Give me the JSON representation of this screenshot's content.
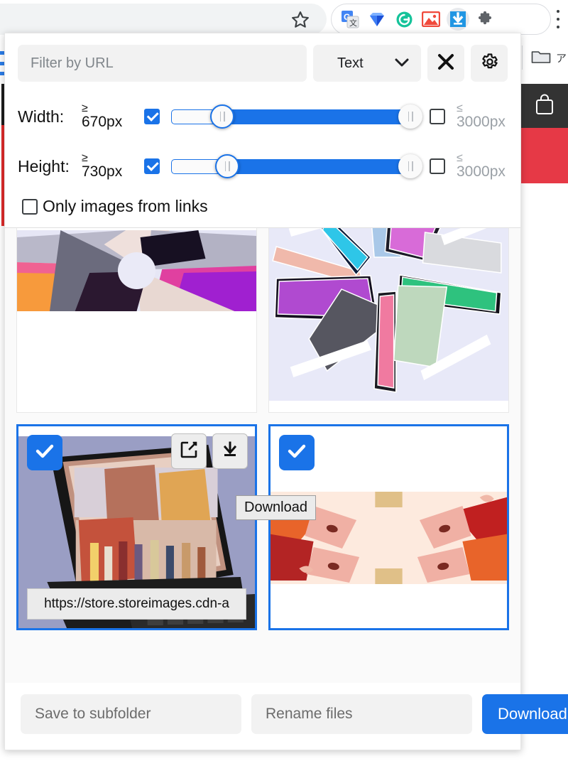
{
  "browser": {
    "star_icon": "star-icon",
    "menu_icon": "kebab-menu-icon",
    "extensions": [
      {
        "name": "google-translate-extension-icon",
        "label": "Google Translate"
      },
      {
        "name": "diamond-extension-icon",
        "label": "Diamond"
      },
      {
        "name": "grammarly-extension-icon",
        "label": "Grammarly"
      },
      {
        "name": "image-extension-icon",
        "label": "Image Downloader"
      },
      {
        "name": "download-all-images-extension-icon",
        "label": "Download All Images"
      },
      {
        "name": "puzzle-extensions-icon",
        "label": "Extensions"
      }
    ],
    "bookmark": {
      "icon": "folder-icon",
      "label": "ア"
    }
  },
  "popup": {
    "filter": {
      "placeholder": "Filter by URL",
      "value": "",
      "type_select": {
        "value": "Text",
        "chevron": "chevron-down-icon"
      },
      "clear_icon": "close-x-icon",
      "settings_icon": "gear-icon"
    },
    "size_filters": [
      {
        "label": "Width:",
        "min_op": "≥",
        "min_value": "670px",
        "min_enabled": true,
        "max_op": "≤",
        "max_value": "3000px",
        "max_enabled": false,
        "fill_start_pct": 21,
        "fill_end_pct": 98
      },
      {
        "label": "Height:",
        "min_op": "≥",
        "min_value": "730px",
        "min_enabled": true,
        "max_op": "≤",
        "max_value": "3000px",
        "max_enabled": false,
        "fill_start_pct": 23,
        "fill_end_pct": 98
      }
    ],
    "only_links": {
      "label": "Only images from links",
      "checked": false
    },
    "tiles": [
      {
        "name": "image-tile-1",
        "selected": false,
        "artwork": "ipad-mini-pinwheel",
        "url": "",
        "show_url": false,
        "show_actions": false,
        "checked": false
      },
      {
        "name": "image-tile-2",
        "selected": false,
        "artwork": "ipad-air-radial",
        "url": "",
        "show_url": false,
        "show_actions": false,
        "checked": false
      },
      {
        "name": "image-tile-3",
        "selected": true,
        "artwork": "ipad-pro-keyboard",
        "url": "https://store.storeimages.cdn-a",
        "show_url": true,
        "show_actions": true,
        "checked": true,
        "open_icon": "open-in-new-tab-icon",
        "download_icon": "download-icon"
      },
      {
        "name": "image-tile-4",
        "selected": true,
        "artwork": "red-orange-mirror",
        "url": "",
        "show_url": false,
        "show_actions": false,
        "checked": true
      }
    ],
    "tooltip": {
      "text": "Download"
    },
    "bottom": {
      "subfolder_placeholder": "Save to subfolder",
      "subfolder_value": "",
      "rename_placeholder": "Rename files",
      "rename_value": "",
      "download_label": "Download"
    }
  },
  "colors": {
    "accent_blue": "#1a73e8",
    "field_grey": "#f2f2f2",
    "grid_bg": "#fafafa",
    "site_red": "#e63946",
    "site_dark": "#333333"
  }
}
